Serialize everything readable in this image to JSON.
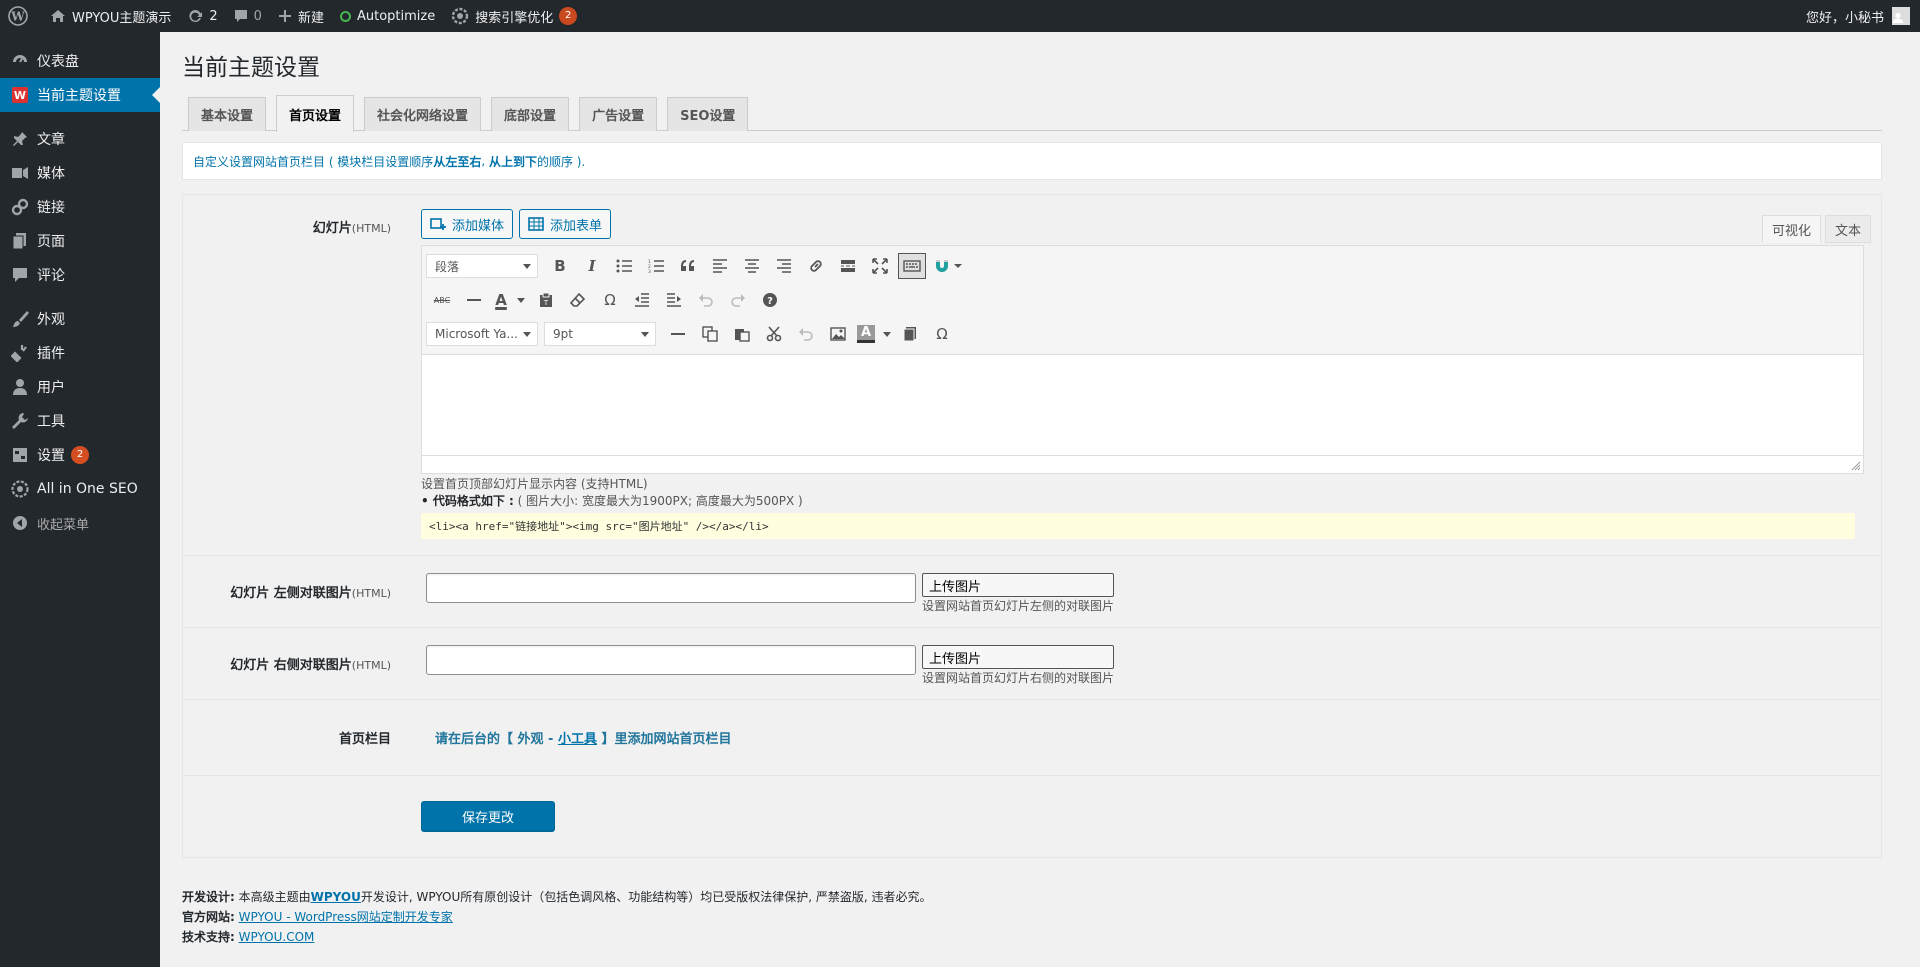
{
  "adminbar": {
    "site_name": "WPYOU主题演示",
    "updates_count": "2",
    "comments_count": "0",
    "new_label": "新建",
    "autoptimize_label": "Autoptimize",
    "seo_label": "搜索引擎优化",
    "seo_badge": "2",
    "greeting": "您好，小秘书"
  },
  "sidebar": {
    "items": [
      {
        "label": "仪表盘",
        "icon": "dashboard-icon"
      },
      {
        "label": "当前主题设置",
        "icon": "theme-w-icon",
        "active": true
      },
      {
        "label": "文章",
        "icon": "pin-icon"
      },
      {
        "label": "媒体",
        "icon": "media-icon"
      },
      {
        "label": "链接",
        "icon": "link-icon"
      },
      {
        "label": "页面",
        "icon": "page-icon"
      },
      {
        "label": "评论",
        "icon": "comment-icon"
      },
      {
        "label": "外观",
        "icon": "brush-icon"
      },
      {
        "label": "插件",
        "icon": "plugin-icon"
      },
      {
        "label": "用户",
        "icon": "user-icon"
      },
      {
        "label": "工具",
        "icon": "wrench-icon"
      },
      {
        "label": "设置",
        "icon": "settings-icon",
        "badge": "2"
      },
      {
        "label": "All in One SEO",
        "icon": "aioseo-icon"
      },
      {
        "label": "收起菜单",
        "icon": "collapse-icon"
      }
    ]
  },
  "page": {
    "title": "当前主题设置",
    "tabs": [
      "基本设置",
      "首页设置",
      "社会化网络设置",
      "底部设置",
      "广告设置",
      "SEO设置"
    ],
    "active_tab": "首页设置",
    "notice_pre": "自定义设置网站首页栏目 ( 模块栏目设置顺序",
    "notice_b1": "从左至右",
    "notice_mid": ", ",
    "notice_b2": "从上到下",
    "notice_post": "的顺序 )."
  },
  "slider": {
    "label": "幻灯片",
    "label_suffix": "(HTML)",
    "add_media": "添加媒体",
    "add_form": "添加表单",
    "tab_visual": "可视化",
    "tab_text": "文本",
    "format_select": "段落",
    "font_select": "Microsoft Ya...",
    "size_select": "9pt",
    "desc": "设置首页顶部幻灯片显示内容 (支持HTML)",
    "format_title": "• 代码格式如下 :",
    "format_note": "( 图片大小: 宽度最大为1900PX; 高度最大为500PX )",
    "code_sample": "<li><a href=\"链接地址\"><img src=\"图片地址\" /></a></li>"
  },
  "left_couplet": {
    "label": "幻灯片 左侧对联图片",
    "label_suffix": "(HTML)",
    "value": "",
    "upload": "上传图片",
    "desc": "设置网站首页幻灯片左侧的对联图片"
  },
  "right_couplet": {
    "label": "幻灯片 右侧对联图片",
    "label_suffix": "(HTML)",
    "value": "",
    "upload": "上传图片",
    "desc": "设置网站首页幻灯片右侧的对联图片"
  },
  "home_columns": {
    "label": "首页栏目",
    "text_pre": "请在后台的【 外观 - ",
    "link": "小工具",
    "text_post": " 】里添加网站首页栏目"
  },
  "save_button": "保存更改",
  "footer": {
    "dev_label": "开发设计:",
    "dev_pre": " 本高级主题由",
    "dev_link": "WPYOU",
    "dev_post": "开发设计, WPYOU所有原创设计（包括色调风格、功能结构等）均已受版权法律保护, 严禁盗版, 违者必究。",
    "site_label": "官方网站:",
    "site_link": "WPYOU - WordPress网站定制开发专家",
    "support_label": "技术支持:",
    "support_link": "WPYOU.COM"
  },
  "colors": {
    "admin_dark": "#23282d",
    "accent": "#0073aa",
    "badge": "#ca4a1f",
    "code_bg": "#ffffe0"
  }
}
